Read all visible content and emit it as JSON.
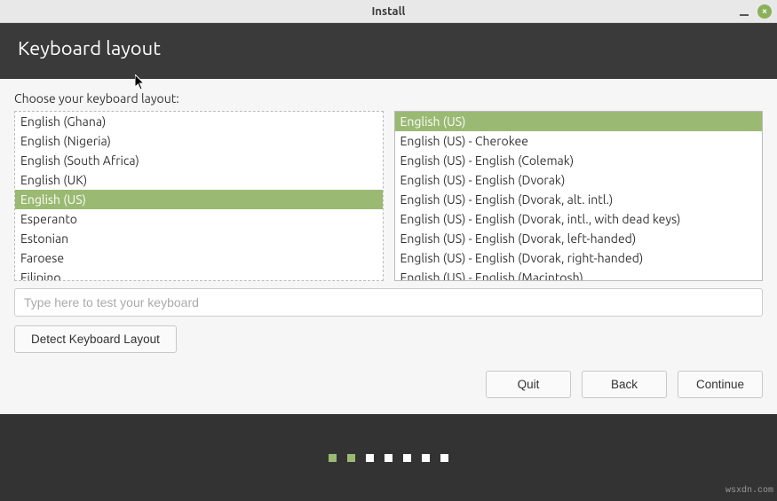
{
  "window": {
    "title": "Install"
  },
  "header": {
    "title": "Keyboard layout"
  },
  "prompt": "Choose your keyboard layout:",
  "layouts": [
    {
      "label": "English (Ghana)",
      "selected": false
    },
    {
      "label": "English (Nigeria)",
      "selected": false
    },
    {
      "label": "English (South Africa)",
      "selected": false
    },
    {
      "label": "English (UK)",
      "selected": false
    },
    {
      "label": "English (US)",
      "selected": true
    },
    {
      "label": "Esperanto",
      "selected": false
    },
    {
      "label": "Estonian",
      "selected": false
    },
    {
      "label": "Faroese",
      "selected": false
    },
    {
      "label": "Filipino",
      "selected": false
    }
  ],
  "variants": [
    {
      "label": "English (US)",
      "selected": true
    },
    {
      "label": "English (US) - Cherokee",
      "selected": false
    },
    {
      "label": "English (US) - English (Colemak)",
      "selected": false
    },
    {
      "label": "English (US) - English (Dvorak)",
      "selected": false
    },
    {
      "label": "English (US) - English (Dvorak, alt. intl.)",
      "selected": false
    },
    {
      "label": "English (US) - English (Dvorak, intl., with dead keys)",
      "selected": false
    },
    {
      "label": "English (US) - English (Dvorak, left-handed)",
      "selected": false
    },
    {
      "label": "English (US) - English (Dvorak, right-handed)",
      "selected": false
    },
    {
      "label": "English (US) - English (Macintosh)",
      "selected": false
    }
  ],
  "test_input": {
    "placeholder": "Type here to test your keyboard"
  },
  "buttons": {
    "detect": "Detect Keyboard Layout",
    "quit": "Quit",
    "back": "Back",
    "continue": "Continue"
  },
  "progress": {
    "total": 7,
    "current": 2
  },
  "watermark": "wsxdn.com"
}
